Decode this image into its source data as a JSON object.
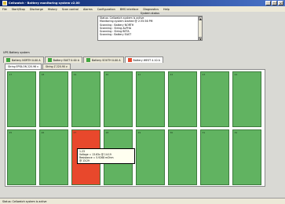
{
  "window": {
    "title": "Cellwatch - Battery monitoring system v2.00"
  },
  "menu": [
    "File",
    "Start/Stop",
    "Discharge",
    "History",
    "Scan control",
    "Alarms",
    "Configuration",
    "BMS interface",
    "Diagnostics",
    "Help"
  ],
  "status_panel": {
    "heading": "System status",
    "lines": [
      "Status: Cellwatch system is active",
      "Monitoring system started @ 2:35:56 PM",
      "Scanning : Battery NORTH",
      "Scanning : String ALPHA",
      "Scanning : String BETA",
      "Scanning : Battery EAST"
    ]
  },
  "ups_label": "UPS Battery system",
  "battery_tabs": [
    {
      "label": "Battery NORTH  0.00 A",
      "color": "#3fa63f"
    },
    {
      "label": "Battery EAST  0.00 A",
      "color": "#3fa63f"
    },
    {
      "label": "Battery SOUTH  0.00 A",
      "color": "#3fa63f"
    },
    {
      "label": "Battery WEST  4.10 A",
      "color": "#e8482c"
    }
  ],
  "string_tabs": [
    "String EPSILON  220.96 v",
    "String Z  220.90 v"
  ],
  "cells": {
    "ok_color": "#61b361",
    "alarm_color": "#e8482c",
    "labels": [
      "17",
      "18",
      "19",
      "20",
      "21",
      "22",
      "23",
      "24",
      "25",
      "26",
      "27",
      "28",
      "29",
      "30",
      "31",
      "32"
    ],
    "alarm_index": 10
  },
  "tooltip": {
    "lines": [
      "1-23",
      "Voltage = 13.63v @ 14:19",
      "Resistance = 5.9268 mOhm",
      "@ 13:29"
    ]
  },
  "statusbar": {
    "text": "Status: Cellwatch system is active"
  }
}
